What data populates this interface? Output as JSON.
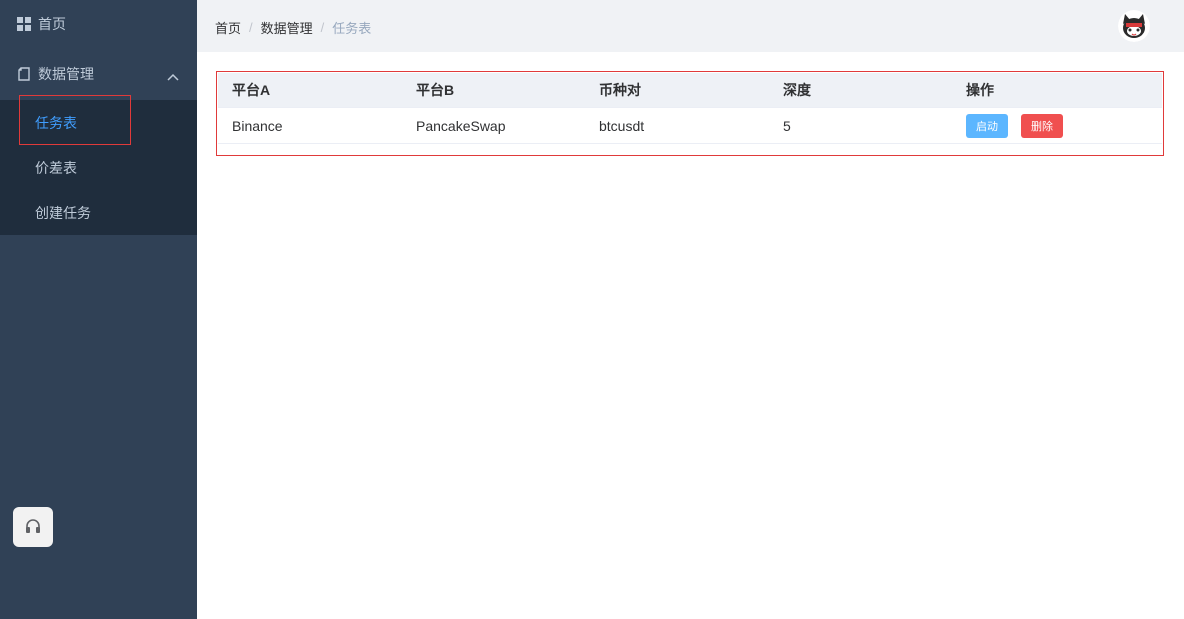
{
  "sidebar": {
    "home_label": "首页",
    "data_mgmt_label": "数据管理",
    "sub_items": [
      {
        "label": "任务表"
      },
      {
        "label": "价差表"
      },
      {
        "label": "创建任务"
      }
    ]
  },
  "breadcrumb": {
    "items": [
      "首页",
      "数据管理",
      "任务表"
    ],
    "separator": "/"
  },
  "table": {
    "columns": [
      "平台A",
      "平台B",
      "币种对",
      "深度",
      "操作"
    ],
    "rows": [
      {
        "platform_a": "Binance",
        "platform_b": "PancakeSwap",
        "pair": "btcusdt",
        "depth": "5",
        "actions": {
          "start": "启动",
          "delete": "删除"
        }
      }
    ]
  },
  "icons": {
    "home": "grid-icon",
    "data_mgmt": "document-icon",
    "expand": "chevron-up-icon",
    "support": "headset-icon",
    "avatar": "avatar-icon"
  },
  "colors": {
    "sidebar_bg": "#304156",
    "submenu_bg": "#1f2d3d",
    "active": "#409eff",
    "start_btn": "#5cb6ff",
    "delete_btn": "#f04f4f",
    "highlight": "#e03a3a"
  }
}
